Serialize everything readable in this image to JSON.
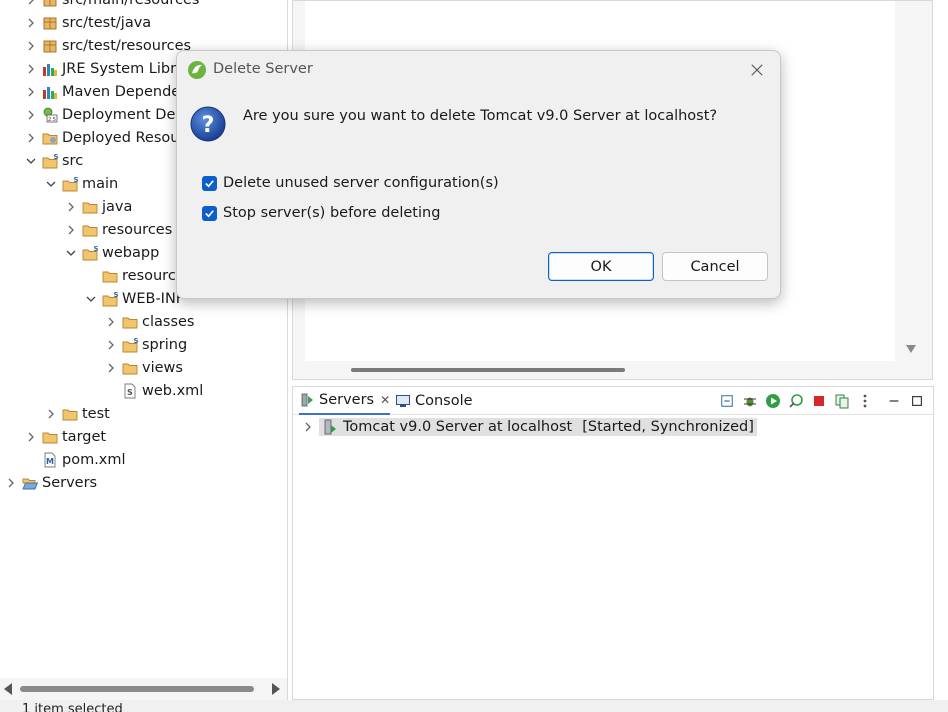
{
  "tree": {
    "items": [
      {
        "label": "src/main/resources",
        "indent": 1,
        "twisty": "collapsed",
        "icon": "package-folder-icon"
      },
      {
        "label": "src/test/java",
        "indent": 1,
        "twisty": "collapsed",
        "icon": "package-folder-icon"
      },
      {
        "label": "src/test/resources",
        "indent": 1,
        "twisty": "collapsed",
        "icon": "package-folder-icon"
      },
      {
        "label": "JRE System Libra",
        "indent": 1,
        "twisty": "collapsed",
        "icon": "library-icon"
      },
      {
        "label": "Maven Depende",
        "indent": 1,
        "twisty": "collapsed",
        "icon": "library-icon"
      },
      {
        "label": "Deployment Des",
        "indent": 1,
        "twisty": "collapsed",
        "icon": "deployment-descriptor-icon"
      },
      {
        "label": "Deployed Resou",
        "indent": 1,
        "twisty": "collapsed",
        "icon": "deployed-resources-icon"
      },
      {
        "label": "src",
        "indent": 1,
        "twisty": "expanded",
        "icon": "source-folder-icon"
      },
      {
        "label": "main",
        "indent": 2,
        "twisty": "expanded",
        "icon": "source-folder-icon"
      },
      {
        "label": "java",
        "indent": 3,
        "twisty": "collapsed",
        "icon": "folder-icon"
      },
      {
        "label": "resources",
        "indent": 3,
        "twisty": "collapsed",
        "icon": "folder-icon"
      },
      {
        "label": "webapp",
        "indent": 3,
        "twisty": "expanded",
        "icon": "source-folder-icon"
      },
      {
        "label": "resource",
        "indent": 4,
        "twisty": "none",
        "icon": "folder-icon"
      },
      {
        "label": "WEB-INF",
        "indent": 4,
        "twisty": "expanded",
        "icon": "source-folder-icon"
      },
      {
        "label": "classes",
        "indent": 5,
        "twisty": "collapsed",
        "icon": "folder-icon"
      },
      {
        "label": "spring",
        "indent": 5,
        "twisty": "collapsed",
        "icon": "source-folder-icon"
      },
      {
        "label": "views",
        "indent": 5,
        "twisty": "collapsed",
        "icon": "folder-icon"
      },
      {
        "label": "web.xml",
        "indent": 5,
        "twisty": "none",
        "icon": "xml-file-icon"
      },
      {
        "label": "test",
        "indent": 2,
        "twisty": "collapsed",
        "icon": "folder-icon"
      },
      {
        "label": "target",
        "indent": 1,
        "twisty": "collapsed",
        "icon": "folder-icon"
      },
      {
        "label": "pom.xml",
        "indent": 1,
        "twisty": "none",
        "icon": "maven-file-icon"
      },
      {
        "label": "Servers",
        "indent": 0,
        "twisty": "collapsed",
        "icon": "open-folder-icon"
      }
    ]
  },
  "status_bar": {
    "text": "1 item selected"
  },
  "servers_view": {
    "tabs": [
      {
        "label": "Servers",
        "icon": "servers-icon",
        "active": true
      },
      {
        "label": "Console",
        "icon": "console-icon",
        "active": false
      }
    ],
    "server": {
      "name": "Tomcat v9.0 Server at localhost",
      "state": "[Started, Synchronized]"
    }
  },
  "dialog": {
    "title": "Delete Server",
    "message": "Are you sure you want to delete Tomcat v9.0 Server at localhost?",
    "options": [
      {
        "label": "Delete unused server configuration(s)",
        "checked": true
      },
      {
        "label": "Stop server(s) before deleting",
        "checked": true
      }
    ],
    "ok_label": "OK",
    "cancel_label": "Cancel"
  },
  "colors": {
    "accent": "#0b5fcc",
    "selection": "#e0e0e0",
    "dialog_bg": "#f0f0f0"
  }
}
